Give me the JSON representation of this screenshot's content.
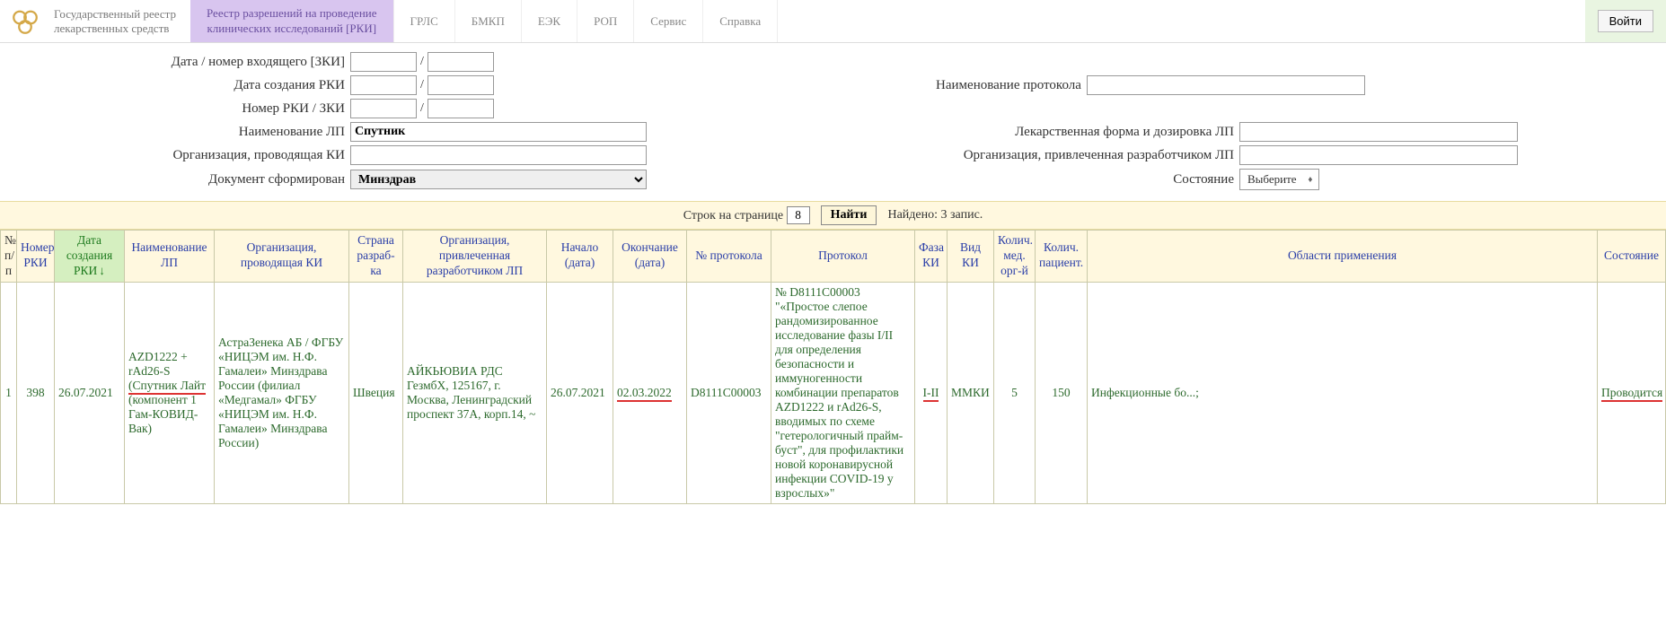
{
  "header": {
    "brand_line1": "Государственный реестр",
    "brand_line2": "лекарственных средств",
    "active_tab_line1": "Реестр разрешений на проведение",
    "active_tab_line2": "клинических исследований [РКИ]",
    "tabs": [
      {
        "label": "ГРЛС"
      },
      {
        "label": "БМКП"
      },
      {
        "label": "ЕЭК"
      },
      {
        "label": "РОП"
      },
      {
        "label": "Сервис"
      },
      {
        "label": "Справка"
      }
    ],
    "login_label": "Войти"
  },
  "filters": {
    "incoming_label": "Дата / номер входящего [ЗКИ]",
    "created_label": "Дата создания РКИ",
    "num_label": "Номер РКИ / ЗКИ",
    "lp_label": "Наименование ЛП",
    "lp_value": "Спутник",
    "org_label": "Организация, проводящая КИ",
    "docform_label": "Документ сформирован",
    "docform_value": "Минздрав",
    "proto_label": "Наименование протокола",
    "formdose_label": "Лекарственная форма и дозировка ЛП",
    "devorg_label": "Организация, привлеченная разработчиком ЛП",
    "state_label": "Состояние",
    "state_value": "Выберите"
  },
  "pager": {
    "rows_label": "Строк на странице",
    "rows_value": "8",
    "find_label": "Найти",
    "found_text": "Найдено: 3 запис."
  },
  "columns": {
    "idx": "№\nп/п",
    "num": "Номер РКИ",
    "date": "Дата создания РКИ",
    "lp": "Наименование ЛП",
    "org": "Организация, проводящая КИ",
    "country": "Страна разраб-ка",
    "devorg": "Организация, привлеченная разработчиком ЛП",
    "start": "Начало (дата)",
    "end": "Окончание (дата)",
    "proto": "№ протокола",
    "protoname": "Протокол",
    "phase": "Фаза КИ",
    "type": "Вид КИ",
    "medn": "Колич. мед. орг-й",
    "pat": "Колич. пациент.",
    "area": "Области применения",
    "state": "Состояние"
  },
  "rows": [
    {
      "idx": "1",
      "num": "398",
      "date": "26.07.2021",
      "lp_l1": "AZD1222 + rAd26-S",
      "lp_l2": "(Спутник Лайт",
      "lp_l3": "(компонент 1 Гам-КОВИД-Вак)",
      "org": "АстраЗенека АБ / ФГБУ «НИЦЭМ им. Н.Ф. Гамалеи» Минздрава России (филиал «Медгамал» ФГБУ «НИЦЭМ им. Н.Ф. Гамалеи» Минздрава России)",
      "country": "Швеция",
      "devorg": "АЙКЬЮВИА РДС ГезмбХ, 125167, г. Москва, Ленинградский проспект 37А, корп.14, ~",
      "start": "26.07.2021",
      "end": "02.03.2022",
      "proto": "D8111C00003",
      "protoname": "№ D8111C00003 \"«Простое слепое рандомизированное исследование фазы I/II для определения безопасности и иммуногенности комбинации препаратов AZD1222 и rAd26-S, вводимых по схеме \"гетерологичный прайм-буст\", для профилактики новой коронавирусной инфекции COVID-19 у взрослых»\"",
      "phase": "I-II",
      "type": "ММКИ",
      "medn": "5",
      "pat": "150",
      "area": "Инфекционные бо...;",
      "state": "Проводится"
    }
  ]
}
